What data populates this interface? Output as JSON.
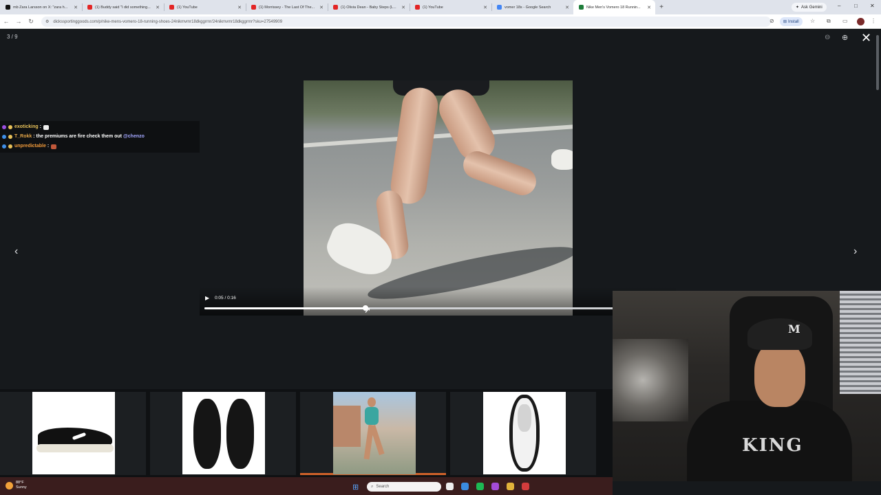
{
  "browser": {
    "tabs": [
      {
        "title": "mb Zara Larsson on X: \"zara h...",
        "color": "#111111",
        "active": false
      },
      {
        "title": "(1) Buddy said \"I did something...",
        "color": "#e32525",
        "active": false
      },
      {
        "title": "(1) YouTube",
        "color": "#e32525",
        "active": false
      },
      {
        "title": "(1) Morrissey - The Last Of The...",
        "color": "#e32525",
        "active": false
      },
      {
        "title": "(1) Olivia Dean - Baby Steps (L...",
        "color": "#e32525",
        "active": false
      },
      {
        "title": "(1) YouTube",
        "color": "#e32525",
        "active": false
      },
      {
        "title": "vomer 18s - Google Search",
        "color": "#4285f4",
        "active": false
      },
      {
        "title": "Nike Men's Vomero 18 Runnin...",
        "color": "#1e7d3a",
        "active": true
      }
    ],
    "new_tab": "+",
    "ask_gemini": "Ask Gemini",
    "url": "dickssportinggoods.com/p/nike-mens-vomero-18-running-shoes-24nikmvmr18dkggrrnr/24nikmvmr18dkggrrnr?sku=27549909",
    "install_label": "Install",
    "window_controls": {
      "minimize": "–",
      "maximize": "□",
      "close": "✕"
    }
  },
  "lightbox": {
    "counter": "3 / 9",
    "icons": {
      "zoom_out": "zoom-out-icon",
      "zoom_in": "zoom-in-icon",
      "close": "close-icon",
      "prev": "chevron-left-icon",
      "next": "chevron-right-icon"
    },
    "close_glyph": "✕",
    "prev_glyph": "‹",
    "next_glyph": "›"
  },
  "chat": [
    {
      "user": "exoticking",
      "sep": " :",
      "message": "",
      "badge_colors": [
        "#9b4fe0",
        "#e8c15a"
      ],
      "emote_color": "#eeeeee"
    },
    {
      "user": "T_Rokk",
      "sep": " :",
      "message": " the premiums are fire check them out ",
      "mention": "@chenzo",
      "badge_colors": [
        "#3f8fe8",
        "#e8c15a"
      ]
    },
    {
      "user": "unpredictable",
      "sep": " :",
      "message": "",
      "badge_colors": [
        "#3f8fe8",
        "#e8c15a"
      ],
      "emote_color": "#c0583a"
    }
  ],
  "video": {
    "time": "0:05 / 0:16",
    "progress": 0.344,
    "icons": {
      "play": "play-icon",
      "volume": "volume-icon",
      "fullscreen": "fullscreen-icon",
      "more": "more-vert-icon"
    }
  },
  "thumbnails": [
    {
      "label": "side-view-shoe",
      "active": false
    },
    {
      "label": "top-view-pair",
      "active": false
    },
    {
      "label": "runner-video",
      "active": true
    },
    {
      "label": "outsole-view",
      "active": false
    }
  ],
  "webcam": {
    "cap_text": "M",
    "shirt_text": "KING"
  },
  "taskbar": {
    "temp": "88°F",
    "condition": "Sunny",
    "search_placeholder": "Search",
    "apps": [
      {
        "name": "file-explorer-icon",
        "color": "#eeeeee"
      },
      {
        "name": "edge-icon",
        "color": "#3b8be0"
      },
      {
        "name": "spotify-icon",
        "color": "#1db954"
      },
      {
        "name": "app-icon",
        "color": "#a44bd8"
      },
      {
        "name": "chrome-icon",
        "color": "#e0b23a"
      },
      {
        "name": "obs-icon",
        "color": "#d23c3c"
      }
    ]
  }
}
